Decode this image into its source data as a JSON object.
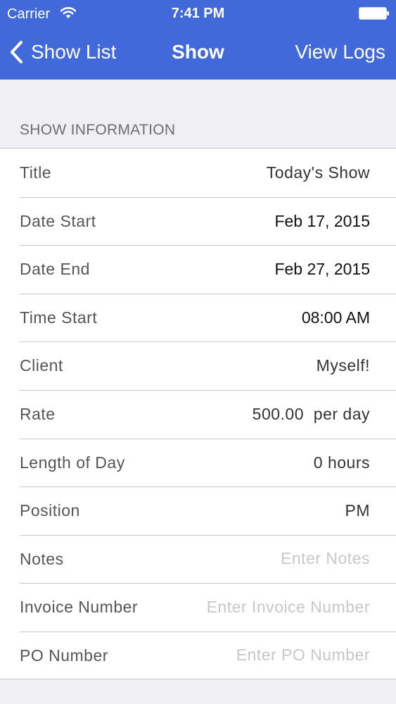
{
  "status_bar": {
    "carrier": "Carrier",
    "time": "7:41 PM",
    "icons": [
      "wifi-icon",
      "battery-icon"
    ]
  },
  "nav": {
    "back_label": "Show List",
    "title": "Show",
    "right_label": "View Logs",
    "color": "#4169d9"
  },
  "section": {
    "header": "SHOW INFORMATION"
  },
  "rows": [
    {
      "label": "Title",
      "value": "Today's Show"
    },
    {
      "label": "Date Start",
      "value": "Feb 17, 2015"
    },
    {
      "label": "Date End",
      "value": "Feb 27, 2015"
    },
    {
      "label": "Time Start",
      "value": "08:00 AM"
    },
    {
      "label": "Client",
      "value": "Myself!"
    },
    {
      "label": "Rate",
      "value": "500.00  per day"
    },
    {
      "label": "Length of Day",
      "value": "0 hours"
    },
    {
      "label": "Position",
      "value": "PM"
    },
    {
      "label": "Notes",
      "value": "",
      "placeholder": "Enter Notes"
    },
    {
      "label": "Invoice Number",
      "value": "",
      "placeholder": "Enter Invoice Number"
    },
    {
      "label": "PO Number",
      "value": "",
      "placeholder": "Enter PO Number"
    }
  ]
}
